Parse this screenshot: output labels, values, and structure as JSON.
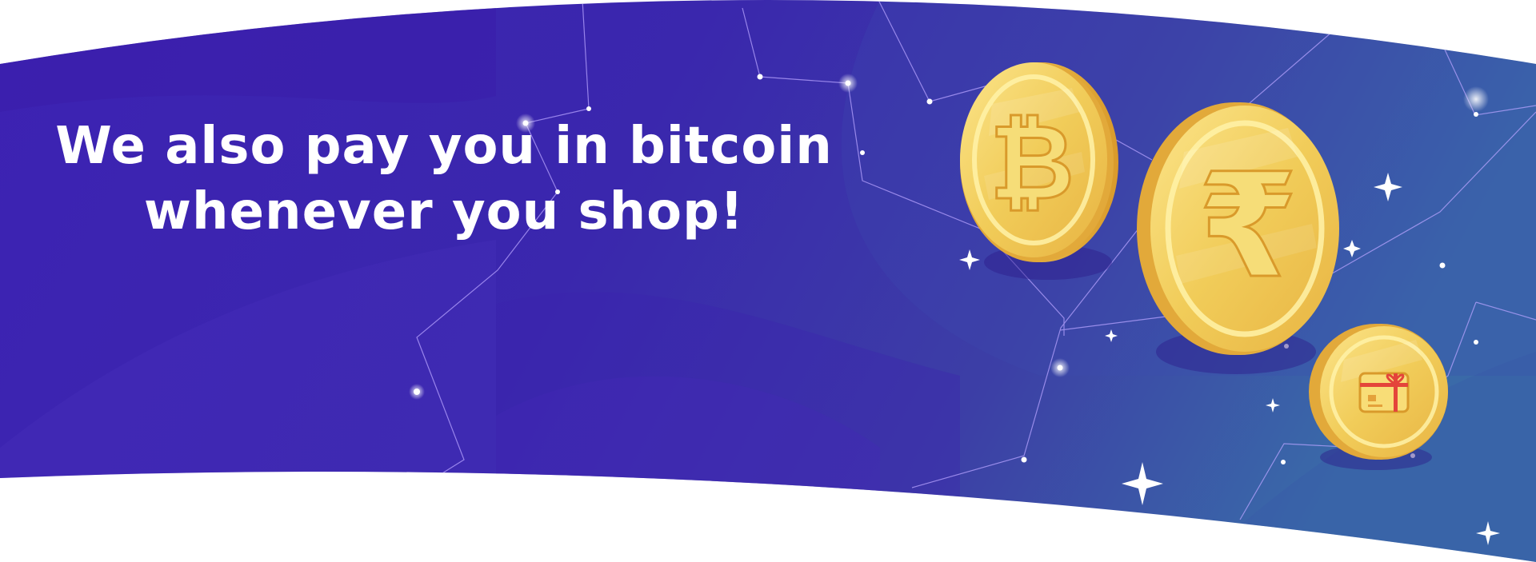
{
  "banner": {
    "headline": {
      "line1": "We also pay you in bitcoin",
      "line2": "whenever you shop!"
    },
    "coins": {
      "bitcoin": {
        "symbol": "₿",
        "icon": "bitcoin-coin-icon"
      },
      "rupee": {
        "symbol": "₹",
        "icon": "rupee-coin-icon"
      },
      "gift_card": {
        "icon": "gift-card-coin-icon"
      }
    },
    "colors": {
      "background_start": "#3b1fb0",
      "background_end": "#3a6aa8",
      "coin_gold": "#f1cf5a",
      "coin_edge": "#e2a93a",
      "headline_text": "#ffffff"
    }
  }
}
